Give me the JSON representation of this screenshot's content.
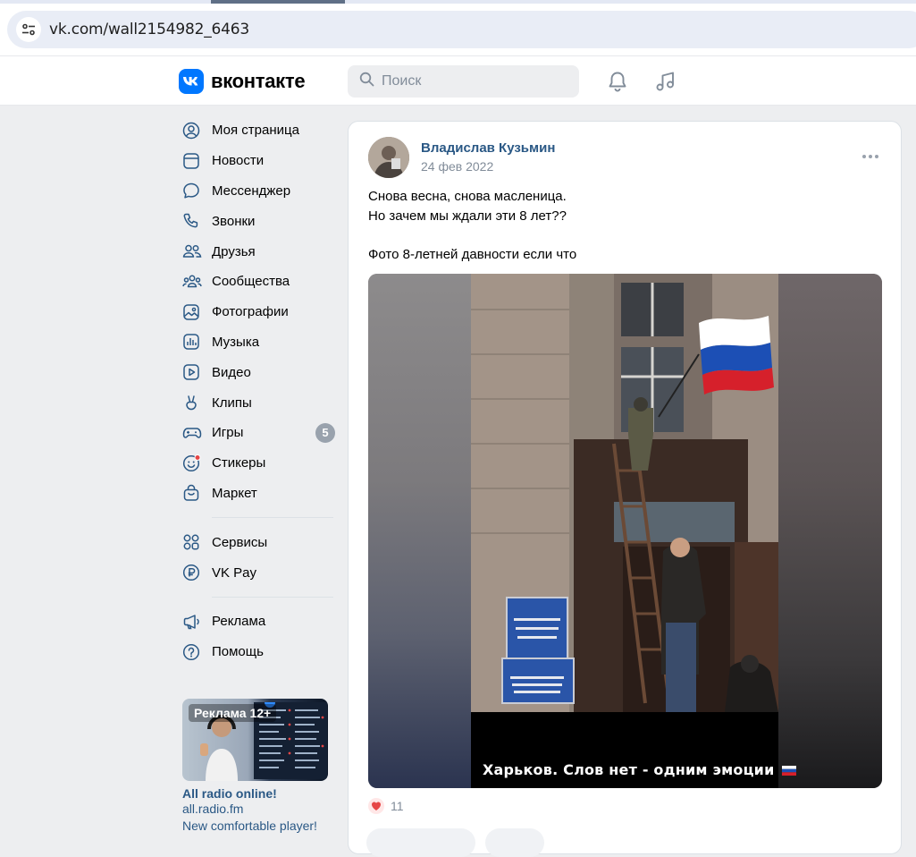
{
  "browser": {
    "url": "vk.com/wall2154982_6463"
  },
  "header": {
    "logo_text": "вконтакте",
    "search_placeholder": "Поиск"
  },
  "nav": {
    "items": [
      {
        "label": "Моя страница",
        "icon": "user-circle-icon"
      },
      {
        "label": "Новости",
        "icon": "newsfeed-icon"
      },
      {
        "label": "Мессенджер",
        "icon": "message-icon"
      },
      {
        "label": "Звонки",
        "icon": "phone-icon"
      },
      {
        "label": "Друзья",
        "icon": "friends-icon"
      },
      {
        "label": "Сообщества",
        "icon": "communities-icon"
      },
      {
        "label": "Фотографии",
        "icon": "photo-icon"
      },
      {
        "label": "Музыка",
        "icon": "music-icon"
      },
      {
        "label": "Видео",
        "icon": "video-icon"
      },
      {
        "label": "Клипы",
        "icon": "clips-icon"
      },
      {
        "label": "Игры",
        "icon": "gamepad-icon",
        "badge": "5"
      },
      {
        "label": "Стикеры",
        "icon": "sticker-icon"
      },
      {
        "label": "Маркет",
        "icon": "market-bag-icon"
      }
    ],
    "items2": [
      {
        "label": "Сервисы",
        "icon": "services-icon"
      },
      {
        "label": "VK Pay",
        "icon": "vkpay-icon"
      }
    ],
    "items3": [
      {
        "label": "Реклама",
        "icon": "megaphone-icon"
      },
      {
        "label": "Помощь",
        "icon": "help-icon"
      }
    ]
  },
  "ad": {
    "tag": "Реклама 12+",
    "title": "All radio online!",
    "domain": "all.radio.fm",
    "description": "New comfortable player!"
  },
  "post": {
    "author": "Владислав Кузьмин",
    "date": "24 фев 2022",
    "text_lines": [
      "Снова весна, снова масленица.",
      "Но зачем мы ждали эти 8 лет??",
      "",
      "Фото 8-летней давности если что"
    ],
    "photo_caption": "Харьков. Слов нет - одним эмоции",
    "photo_sign_1": "УКРАЇНА ХАРКІВСЬКА ОБЛАСНА РАДА",
    "photo_sign_2": "УКРАЇНА ХАРКІВСЬКА ОБЛАСНА ДЕРЖАВНА АДМІНІСТРАЦІЯ",
    "likes_count": "11"
  },
  "colors": {
    "vk_blue": "#0077ff",
    "link": "#2a5885",
    "muted": "#818c99",
    "like_red": "#e64646"
  }
}
